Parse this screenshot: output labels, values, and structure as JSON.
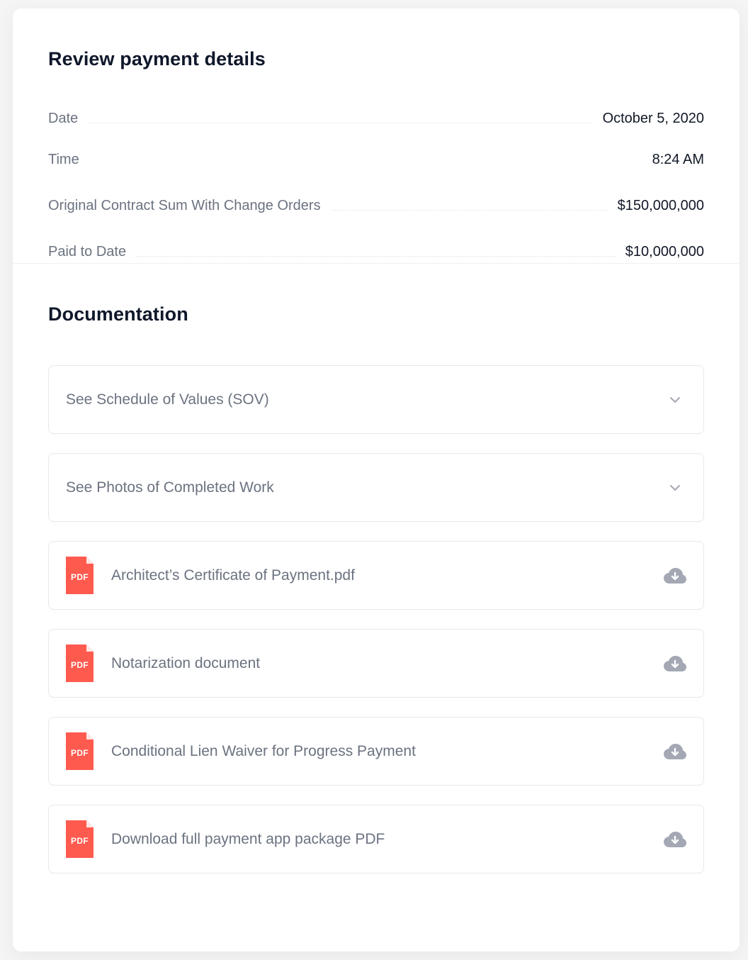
{
  "review": {
    "title": "Review payment details",
    "rows": [
      {
        "label": "Date",
        "value": "October 5, 2020"
      },
      {
        "label": "Time",
        "value": "8:24 AM"
      },
      {
        "label": "Original Contract Sum With Change Orders",
        "value": "$150,000,000"
      },
      {
        "label": "Paid to Date",
        "value": "$10,000,000"
      }
    ]
  },
  "documentation": {
    "title": "Documentation",
    "items": [
      {
        "label": "See Schedule of Values (SOV)",
        "type": "accordion",
        "icon": "chevron-down-icon"
      },
      {
        "label": "See Photos of Completed Work",
        "type": "accordion",
        "icon": "chevron-down-icon"
      },
      {
        "label": "Architect’s Certificate of Payment.pdf",
        "type": "file",
        "icon": "cloud-download-icon",
        "badge": "PDF"
      },
      {
        "label": "Notarization document",
        "type": "file",
        "icon": "cloud-download-icon",
        "badge": "PDF"
      },
      {
        "label": "Conditional Lien Waiver for Progress Payment",
        "type": "file",
        "icon": "cloud-download-icon",
        "badge": "PDF"
      },
      {
        "label": "Download full payment app package PDF",
        "type": "file",
        "icon": "cloud-download-icon",
        "badge": "PDF"
      }
    ]
  },
  "colors": {
    "pdf": "#ff5a4e",
    "icon_gray": "#a3a8b3",
    "label_gray": "#6b7280",
    "heading": "#0f172a"
  }
}
